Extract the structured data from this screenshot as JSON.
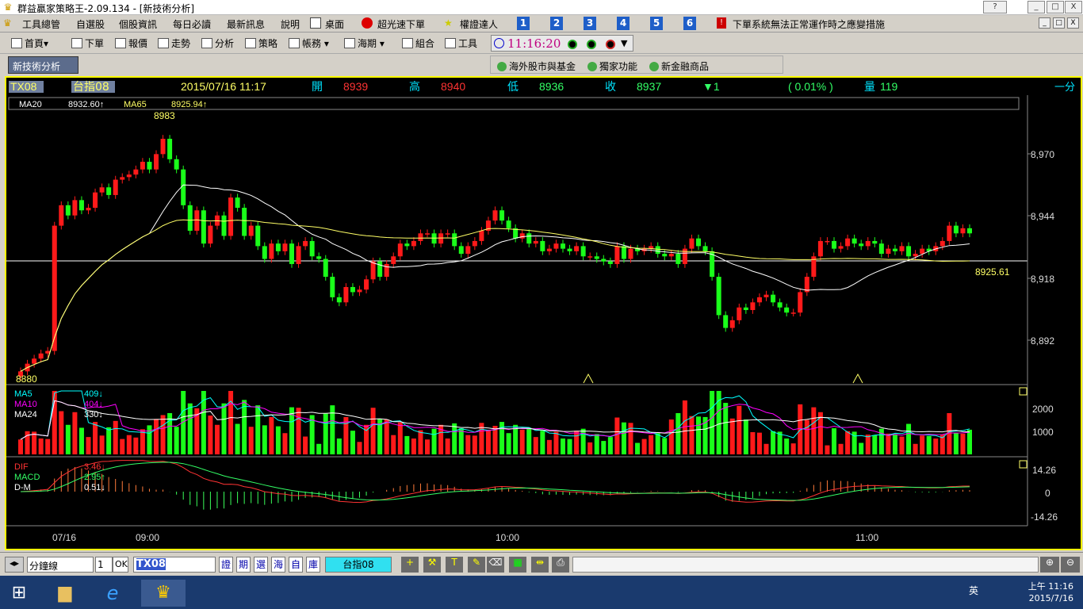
{
  "window": {
    "title": "群益贏家策略王-2.09.134 - [新技術分析]",
    "help_label": "?",
    "min_label": "_",
    "max_label": "□",
    "close_label": "X"
  },
  "menu": {
    "items": [
      "工具總管",
      "自選股",
      "個股資訊",
      "每日必讀",
      "最新訊息",
      "說明",
      "桌面",
      "超光速下單",
      "權證達人"
    ],
    "numbers": [
      "1",
      "2",
      "3",
      "4",
      "5",
      "6"
    ],
    "notice": "下單系統無法正常運作時之應變措施"
  },
  "toolbar": {
    "items": [
      "首頁",
      "下單",
      "報價",
      "走勢",
      "分析",
      "策略",
      "帳務",
      "海期",
      "組合",
      "工具"
    ],
    "clock": "11:16:20"
  },
  "tabs": {
    "active": "新技術分析",
    "right_items": [
      "海外股市與基金",
      "獨家功能",
      "新金融商品"
    ]
  },
  "header": {
    "symbol": "TX08",
    "name": "台指08",
    "datetime": "2015/07/16 11:17",
    "open_label": "開",
    "open": "8939",
    "high_label": "高",
    "high": "8940",
    "low_label": "低",
    "low": "8936",
    "close_label": "收",
    "close": "8937",
    "change": "▼1",
    "pct": "( 0.01% )",
    "vol_label": "量",
    "volume": "119",
    "period": "一分"
  },
  "ma_legend": {
    "ma20_label": "MA20",
    "ma20": "8932.60↑",
    "ma65_label": "MA65",
    "ma65": "8925.94↑"
  },
  "price_labels": {
    "high_mark": "8983",
    "low_mark": "8880",
    "current": "8925.61"
  },
  "vol_legend": {
    "ma5_label": "MA5",
    "ma5": "409↓",
    "ma10_label": "MA10",
    "ma10": "404↓",
    "ma24_label": "MA24",
    "ma24": "330↓"
  },
  "macd_legend": {
    "dif_label": "DIF",
    "dif": "3.46↓",
    "macd_label": "MACD",
    "macd": "2.95↑",
    "dm_label": "D-M",
    "dm": "0.51↓"
  },
  "axes": {
    "price_ticks": [
      "8,970",
      "8,944",
      "8,918",
      "8,892"
    ],
    "vol_ticks": [
      "2000",
      "1000"
    ],
    "macd_ticks": [
      "14.26",
      "0",
      "-14.26"
    ],
    "time_ticks": [
      "07/16",
      "09:00",
      "10:00",
      "11:00"
    ]
  },
  "statusbar": {
    "interval": "分鐘線",
    "count": "1",
    "ok": "OK",
    "symbol": "TX08",
    "buttons": [
      "證",
      "期",
      "選",
      "海",
      "自",
      "庫"
    ],
    "name": "台指08"
  },
  "tray": {
    "ime": "英",
    "time": "上午 11:16",
    "date": "2015/7/16"
  },
  "colors": {
    "up": "#ff0000",
    "down": "#00ff00",
    "ma20": "#ffffff",
    "ma65": "#ffff66",
    "border": "#ffff00",
    "clock": "#c00080"
  },
  "chart_data": {
    "type": "candlestick",
    "symbol": "TX08",
    "interval": "1 minute",
    "price_axis": [
      8880,
      8983
    ],
    "price_ticks": [
      8970,
      8944,
      8918,
      8892
    ],
    "candles_close": [
      8883,
      8886,
      8888,
      8890,
      8891,
      8940,
      8948,
      8944,
      8950,
      8946,
      8947,
      8953,
      8955,
      8952,
      8958,
      8959,
      8960,
      8962,
      8965,
      8962,
      8968,
      8974,
      8966,
      8962,
      8948,
      8938,
      8946,
      8933,
      8940,
      8944,
      8936,
      8951,
      8947,
      8936,
      8940,
      8932,
      8927,
      8933,
      8930,
      8933,
      8925,
      8932,
      8934,
      8928,
      8927,
      8920,
      8912,
      8910,
      8916,
      8914,
      8915,
      8919,
      8926,
      8920,
      8925,
      8928,
      8933,
      8932,
      8934,
      8937,
      8937,
      8933,
      8937,
      8937,
      8932,
      8929,
      8932,
      8934,
      8938,
      8942,
      8946,
      8942,
      8939,
      8935,
      8937,
      8933,
      8934,
      8930,
      8931,
      8933,
      8931,
      8930,
      8932,
      8928,
      8928,
      8927,
      8926,
      8925,
      8932,
      8927,
      8931,
      8930,
      8931,
      8932,
      8929,
      8928,
      8929,
      8925,
      8931,
      8935,
      8932,
      8930,
      8920,
      8905,
      8900,
      8903,
      8908,
      8907,
      8910,
      8912,
      8913,
      8910,
      8908,
      8906,
      8906,
      8914,
      8920,
      8928,
      8934,
      8934,
      8931,
      8932,
      8935,
      8933,
      8932,
      8934,
      8933,
      8929,
      8931,
      8930,
      8932,
      8928,
      8929,
      8931,
      8930,
      8932,
      8934,
      8940,
      8937,
      8939,
      8937
    ]
  }
}
